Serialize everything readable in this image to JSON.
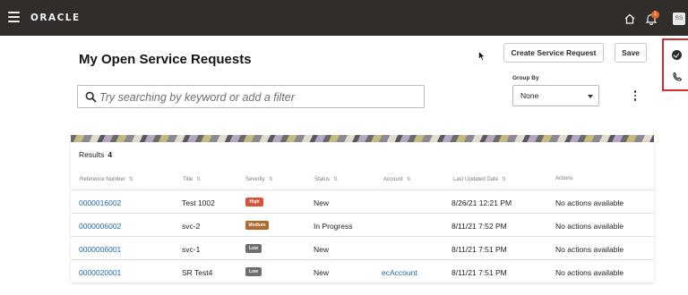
{
  "header": {
    "logo": "ORACLE",
    "notification_count": "1",
    "avatar_initials": "SS"
  },
  "page": {
    "title": "My Open Service Requests",
    "search_placeholder": "Try searching by keyword or add a filter",
    "create_button": "Create Service Request",
    "save_button": "Save",
    "group_by_label": "Group By",
    "group_by_value": "None"
  },
  "results": {
    "label": "Results",
    "count": "4",
    "columns": [
      "Reference Number",
      "Title",
      "Severity",
      "Status",
      "Account",
      "Last Updated Date",
      "Actions"
    ],
    "rows": [
      {
        "ref": "0000016002",
        "title": "Test 1002",
        "severity": "High",
        "status": "New",
        "account": "",
        "updated": "8/26/21 12:21 PM",
        "actions": "No actions available"
      },
      {
        "ref": "0000006002",
        "title": "svc-2",
        "severity": "Medium",
        "status": "In Progress",
        "account": "",
        "updated": "8/11/21 7:52 PM",
        "actions": "No actions available"
      },
      {
        "ref": "0000006001",
        "title": "svc-1",
        "severity": "Low",
        "status": "New",
        "account": "",
        "updated": "8/11/21 7:51 PM",
        "actions": "No actions available"
      },
      {
        "ref": "0000020001",
        "title": "SR Test4",
        "severity": "Low",
        "status": "New",
        "account": "ecAccount",
        "updated": "8/11/21 7:51 PM",
        "actions": "No actions available"
      }
    ]
  },
  "colors": {
    "topbar": "#312d2a",
    "link": "#2368a8",
    "severity_high": "#d9533a",
    "severity_medium": "#b26a2a",
    "severity_low": "#6e6e6e",
    "highlight_border": "#d22c2c"
  }
}
